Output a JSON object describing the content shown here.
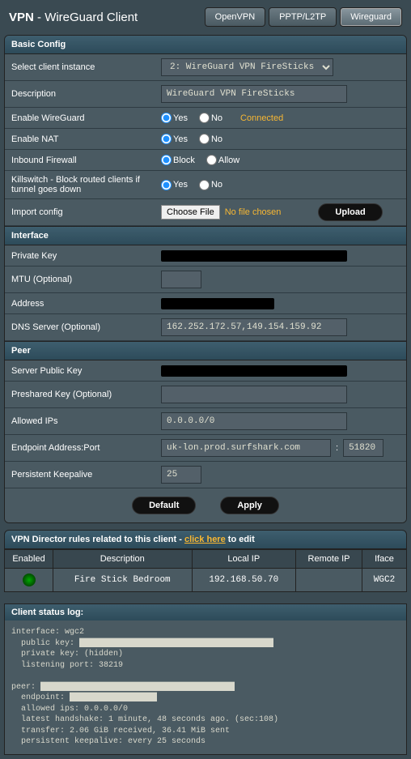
{
  "header": {
    "title_prefix": "VPN",
    "title_suffix": "WireGuard Client"
  },
  "tabs": {
    "openvpn": "OpenVPN",
    "pptp": "PPTP/L2TP",
    "wireguard": "Wireguard"
  },
  "sections": {
    "basic": "Basic Config",
    "interface": "Interface",
    "peer": "Peer"
  },
  "basic": {
    "instance_label": "Select client instance",
    "instance_value": "2: WireGuard VPN FireSticks",
    "desc_label": "Description",
    "desc_value": "WireGuard VPN FireSticks",
    "enable_label": "Enable WireGuard",
    "enable_value": "yes",
    "connected_text": "Connected",
    "nat_label": "Enable NAT",
    "nat_value": "yes",
    "fw_label": "Inbound Firewall",
    "fw_value": "block",
    "ks_label": "Killswitch - Block routed clients if tunnel goes down",
    "ks_value": "yes",
    "yes": "Yes",
    "no": "No",
    "block": "Block",
    "allow": "Allow",
    "import_label": "Import config",
    "choose_file": "Choose File",
    "no_file": "No file chosen",
    "upload": "Upload"
  },
  "iface": {
    "privkey_label": "Private Key",
    "mtu_label": "MTU (Optional)",
    "mtu_value": "",
    "addr_label": "Address",
    "dns_label": "DNS Server (Optional)",
    "dns_value": "162.252.172.57,149.154.159.92"
  },
  "peer": {
    "pubkey_label": "Server Public Key",
    "psk_label": "Preshared Key (Optional)",
    "psk_value": "",
    "allowed_label": "Allowed IPs",
    "allowed_value": "0.0.0.0/0",
    "endpoint_label": "Endpoint Address:Port",
    "endpoint_host": "uk-lon.prod.surfshark.com",
    "endpoint_port": "51820",
    "keepalive_label": "Persistent Keepalive",
    "keepalive_value": "25"
  },
  "buttons": {
    "default": "Default",
    "apply": "Apply"
  },
  "director": {
    "heading_pre": "VPN Director rules related to this client - ",
    "heading_link": "click here",
    "heading_post": " to edit",
    "cols": {
      "enabled": "Enabled",
      "desc": "Description",
      "local": "Local IP",
      "remote": "Remote IP",
      "iface": "Iface"
    },
    "rows": [
      {
        "enabled": true,
        "desc": "Fire Stick Bedroom",
        "local": "192.168.50.70",
        "remote": "",
        "iface": "WGC2"
      }
    ]
  },
  "log": {
    "heading": "Client status log:",
    "text": "interface: wgc2\n  public key: ████████████████████████████████████████\n  private key: (hidden)\n  listening port: 38219\n\npeer: ████████████████████████████████████████\n  endpoint: ██████████████████\n  allowed ips: 0.0.0.0/0\n  latest handshake: 1 minute, 48 seconds ago. (sec:108)\n  transfer: 2.06 GiB received, 36.41 MiB sent\n  persistent keepalive: every 25 seconds"
  }
}
